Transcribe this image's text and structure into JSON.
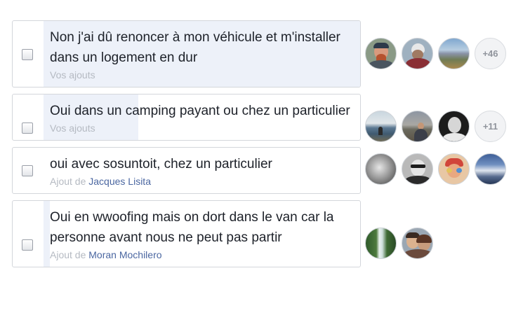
{
  "options": [
    {
      "text": "Non j'ai dû renoncer à mon véhicule et m'installer dans un logement en dur",
      "meta_prefix": "Vos ajouts",
      "meta_author": "",
      "vote_share": 1.0,
      "more_label": "+46",
      "avatars": [
        "avatar-man-red-beard",
        "avatar-man-helmet",
        "avatar-mountain-landscape"
      ]
    },
    {
      "text": "Oui dans un camping payant ou chez un particulier",
      "meta_prefix": "Vos ajouts",
      "meta_author": "",
      "vote_share": 0.3,
      "more_label": "+11",
      "avatars": [
        "avatar-lake-landscape",
        "avatar-person-field",
        "avatar-man-dark-bw"
      ]
    },
    {
      "text": "oui avec sosuntoit, chez un particulier",
      "meta_prefix": "Ajout de",
      "meta_author": "Jacques Lisita",
      "vote_share": 0.0,
      "more_label": "",
      "avatars": [
        "avatar-hands-bw",
        "avatar-man-sunglasses-bw",
        "avatar-woman-colorful",
        "avatar-mountain-sky"
      ]
    },
    {
      "text": "Oui en wwoofing mais on dort dans le van car la personne avant nous ne peut pas partir",
      "meta_prefix": "Ajout de",
      "meta_author": "Moran Mochilero",
      "vote_share": 0.02,
      "more_label": "",
      "avatars": [
        "avatar-waterfall",
        "avatar-couple"
      ]
    }
  ]
}
